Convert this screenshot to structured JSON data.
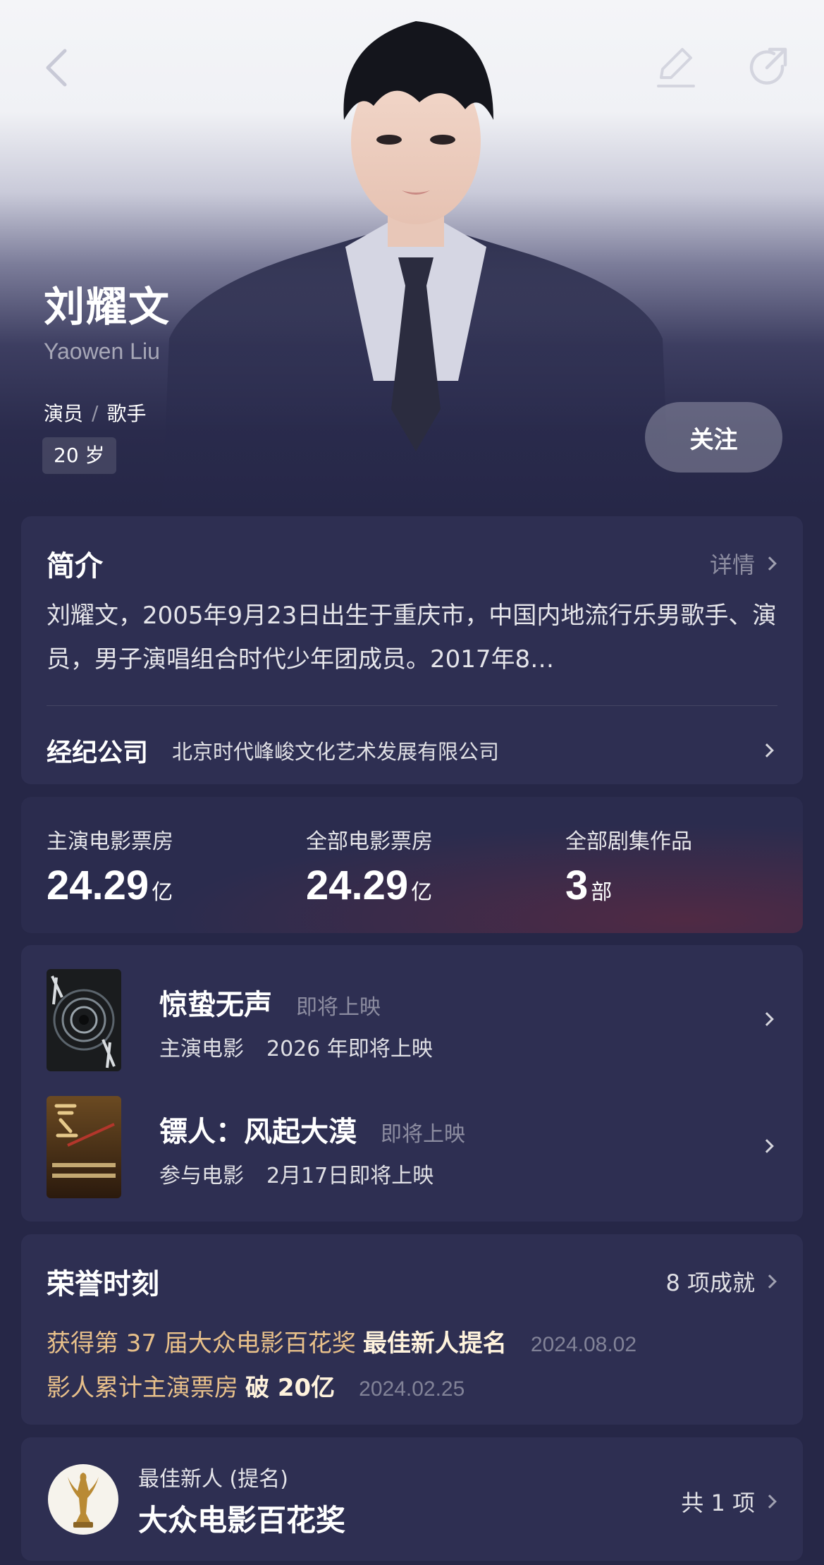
{
  "header": {
    "name_zh": "刘耀文",
    "name_en": "Yaowen Liu",
    "roles": [
      "演员",
      "歌手"
    ],
    "role_separator": "/",
    "age": "20 岁",
    "follow_label": "关注"
  },
  "intro": {
    "title": "简介",
    "detail_label": "详情",
    "bio": "刘耀文，2005年9月23日出生于重庆市，中国内地流行乐男歌手、演员，男子演唱组合时代少年团成员。2017年8…",
    "agency_label": "经纪公司",
    "agency_name": "北京时代峰峻文化艺术发展有限公司"
  },
  "stats": [
    {
      "label": "主演电影票房",
      "value": "24.29",
      "unit": "亿"
    },
    {
      "label": "全部电影票房",
      "value": "24.29",
      "unit": "亿"
    },
    {
      "label": "全部剧集作品",
      "value": "3",
      "unit": "部"
    }
  ],
  "works": [
    {
      "title": "惊蛰无声",
      "status": "即将上映",
      "role": "主演电影",
      "release": "2026 年即将上映"
    },
    {
      "title": "镖人：风起大漠",
      "status": "即将上映",
      "role": "参与电影",
      "release": "2月17日即将上映"
    }
  ],
  "honors": {
    "title": "荣誉时刻",
    "count_label": "8 项成就",
    "items": [
      {
        "text": "获得第 37 届大众电影百花奖",
        "highlight": "最佳新人提名",
        "date": "2024.08.02"
      },
      {
        "text": "影人累计主演票房",
        "highlight": "破 20亿",
        "date": "2024.02.25"
      }
    ]
  },
  "award": {
    "category": "最佳新人 (提名)",
    "name": "大众电影百花奖",
    "total_label": "共 1 项"
  },
  "colors": {
    "background": "#262747",
    "card": "#2e2f52",
    "honor_gold": "#e8c08a"
  }
}
